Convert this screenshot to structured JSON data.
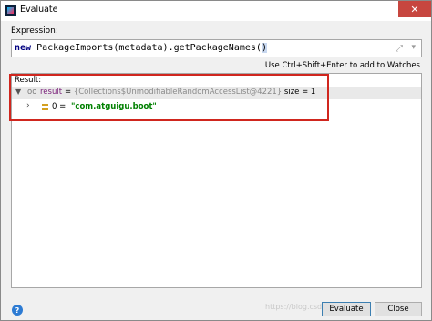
{
  "window": {
    "title": "Evaluate",
    "close_glyph": "✕"
  },
  "expression": {
    "label": "Expression:",
    "keyword": "new",
    "code": " PackageImports(metadata).getPackageNames(",
    "highlighted_paren": ")",
    "hint": "Use Ctrl+Shift+Enter to add to Watches"
  },
  "result": {
    "label": "Result:",
    "root": {
      "icon": "oo",
      "name": "result",
      "equals": " = ",
      "ref": "{Collections$UnmodifiableRandomAccessList@4221}",
      "size_text": "  size = 1"
    },
    "child": {
      "index": "0 = ",
      "value": "\"com.atguigu.boot\""
    }
  },
  "footer": {
    "help": "?",
    "watermark": "https://blog.csdn.net/...",
    "evaluate_label": "Evaluate",
    "close_label": "Close"
  },
  "colors": {
    "annotation_border": "#d0261e",
    "string_value": "#008000",
    "var_name": "#7a1f7a"
  }
}
